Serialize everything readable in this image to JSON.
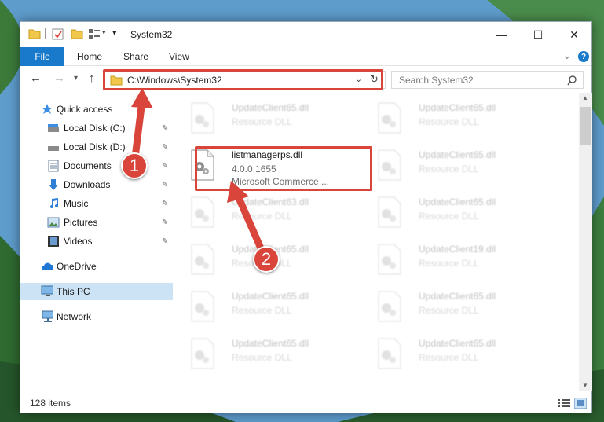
{
  "titlebar": {
    "title": "System32",
    "minimize": "—",
    "maximize": "☐",
    "close": "✕"
  },
  "ribbon": {
    "file": "File",
    "tabs": [
      "Home",
      "Share",
      "View"
    ],
    "expand": "⌄",
    "help": "?"
  },
  "address": {
    "path": "C:\\Windows\\System32",
    "search_placeholder": "Search System32"
  },
  "sidebar": {
    "items": [
      {
        "label": "Quick access",
        "icon": "star-icon"
      },
      {
        "label": "Local Disk (C:)",
        "icon": "drive-icon"
      },
      {
        "label": "Local Disk (D:)",
        "icon": "drive-icon"
      },
      {
        "label": "Documents",
        "icon": "documents-icon"
      },
      {
        "label": "Downloads",
        "icon": "downloads-icon"
      },
      {
        "label": "Music",
        "icon": "music-icon"
      },
      {
        "label": "Pictures",
        "icon": "pictures-icon"
      },
      {
        "label": "Videos",
        "icon": "videos-icon"
      },
      {
        "label": "OneDrive",
        "icon": "cloud-icon"
      },
      {
        "label": "This PC",
        "icon": "computer-icon"
      },
      {
        "label": "Network",
        "icon": "network-icon"
      }
    ],
    "pin_glyph": "📌"
  },
  "files": {
    "highlighted": {
      "name": "listmanagerps.dll",
      "version": "4.0.0.1655",
      "company": "Microsoft Commerce ..."
    },
    "left_column": [
      {
        "name": "UpdateClient65.dll",
        "type": "Resource DLL"
      },
      {
        "name": "UpdateClient63.dll",
        "type": "Resource DLL"
      },
      {
        "name": "UpdateClient65.dll",
        "type": "Resource DLL"
      },
      {
        "name": "UpdateClient65.dll",
        "type": "Resource DLL"
      },
      {
        "name": "UpdateClient65.dll",
        "type": "Resource DLL"
      }
    ],
    "right_column": [
      {
        "name": "UpdateClient65.dll",
        "type": "Resource DLL"
      },
      {
        "name": "UpdateClient65.dll",
        "type": "Resource DLL"
      },
      {
        "name": "UpdateClient65.dll",
        "type": "Resource DLL"
      },
      {
        "name": "UpdateClient19.dll",
        "type": "Resource DLL"
      },
      {
        "name": "UpdateClient65.dll",
        "type": "Resource DLL"
      },
      {
        "name": "UpdateClient65.dll",
        "type": "Resource DLL"
      }
    ]
  },
  "status": {
    "item_count": "128 items"
  },
  "markers": {
    "one": "1",
    "two": "2"
  },
  "colors": {
    "accent": "#1979ca",
    "highlight_red": "#d9453a",
    "selection": "#cce3f5"
  }
}
